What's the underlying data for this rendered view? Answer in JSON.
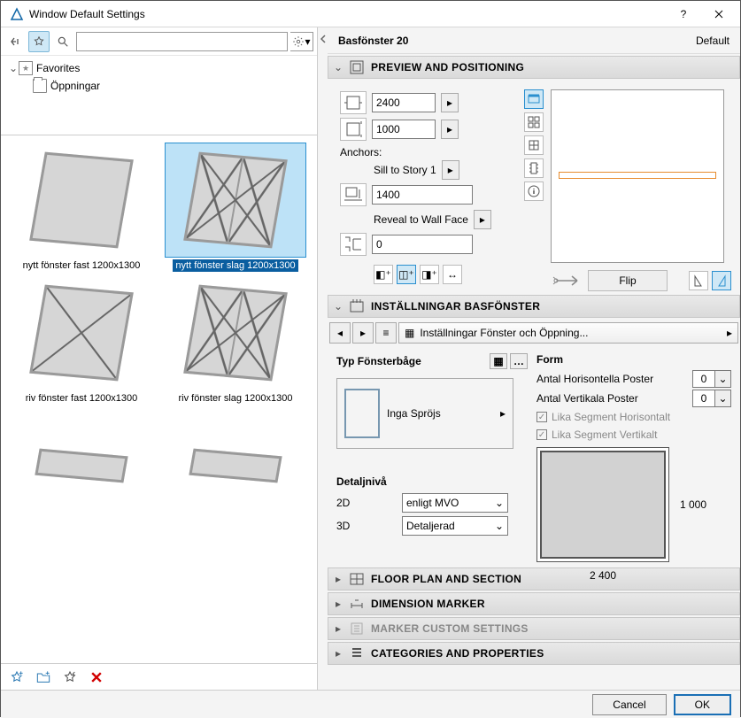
{
  "window": {
    "title": "Window Default Settings"
  },
  "tree": {
    "root": "Favorites",
    "child": "Öppningar"
  },
  "gallery": {
    "items": [
      {
        "label": "nytt fönster fast 1200x1300",
        "selected": false,
        "style": "plain"
      },
      {
        "label": "nytt fönster slag 1200x1300",
        "selected": true,
        "style": "splitx"
      },
      {
        "label": "riv fönster fast 1200x1300",
        "selected": false,
        "style": "x"
      },
      {
        "label": "riv fönster slag 1200x1300",
        "selected": false,
        "style": "splitx"
      }
    ]
  },
  "right": {
    "name": "Basfönster 20",
    "defaultLabel": "Default",
    "sections": {
      "preview": "PREVIEW AND POSITIONING",
      "settings": "INSTÄLLNINGAR BASFÖNSTER",
      "floor": "FLOOR PLAN AND SECTION",
      "dim": "DIMENSION MARKER",
      "custom": "MARKER CUSTOM SETTINGS",
      "cats": "CATEGORIES AND PROPERTIES"
    },
    "preview": {
      "width": "2400",
      "height": "1000",
      "anchorsLabel": "Anchors:",
      "sillLabel": "Sill to Story 1",
      "sillValue": "1400",
      "revealLabel": "Reveal to Wall Face",
      "revealValue": "0",
      "flip": "Flip"
    },
    "settings": {
      "crumb": "Inställningar Fönster och Öppning...",
      "typLabel": "Typ Fönsterbåge",
      "sashLabel": "Inga Spröjs",
      "formLabel": "Form",
      "horizPoster": "Antal Horisontella Poster",
      "vertPoster": "Antal Vertikala Poster",
      "horizVal": "0",
      "vertVal": "0",
      "chk1": "Lika Segment Horisontalt",
      "chk2": "Lika Segment Vertikalt",
      "dimH": "2 400",
      "dimV": "1 000",
      "detaljTitle": "Detaljnivå",
      "lbl2d": "2D",
      "lbl3d": "3D",
      "val2d": "enligt MVO",
      "val3d": "Detaljerad"
    }
  },
  "footer": {
    "cancel": "Cancel",
    "ok": "OK"
  }
}
